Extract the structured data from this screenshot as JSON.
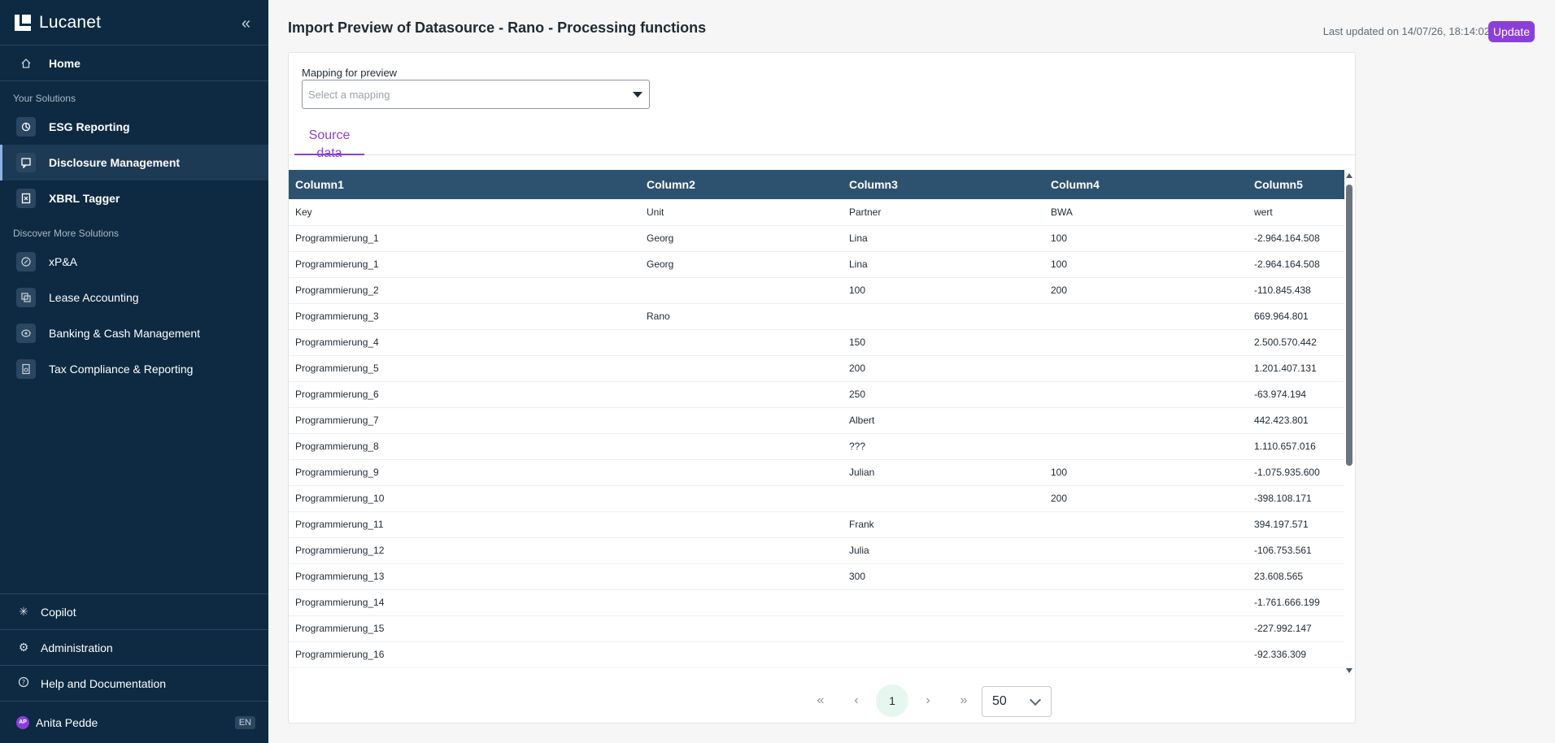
{
  "app": {
    "brand": "Lucanet"
  },
  "sidebar": {
    "home_label": "Home",
    "your_solutions_label": "Your Solutions",
    "your_solutions": [
      {
        "label": "ESG Reporting",
        "icon": "esg-icon"
      },
      {
        "label": "Disclosure Management",
        "icon": "disclosure-icon",
        "active": true
      },
      {
        "label": "XBRL Tagger",
        "icon": "xbrl-icon"
      }
    ],
    "discover_label": "Discover More Solutions",
    "discover": [
      {
        "label": "xP&A",
        "icon": "xpa-icon"
      },
      {
        "label": "Lease Accounting",
        "icon": "lease-icon"
      },
      {
        "label": "Banking & Cash Management",
        "icon": "banking-icon"
      },
      {
        "label": "Tax Compliance & Reporting",
        "icon": "tax-icon"
      }
    ],
    "bottom": {
      "copilot": "Copilot",
      "administration": "Administration",
      "help": "Help and Documentation",
      "user_name": "Anita Pedde",
      "user_initials": "AP",
      "language": "EN"
    }
  },
  "header": {
    "title": "Import Preview of Datasource - Rano - Processing functions",
    "last_updated": "Last updated on 14/07/26, 18:14:02",
    "update_label": "Update"
  },
  "mapping": {
    "label": "Mapping for preview",
    "placeholder": "Select a mapping"
  },
  "tabs": {
    "source_data": "Source data"
  },
  "table": {
    "columns": [
      "Column1",
      "Column2",
      "Column3",
      "Column4",
      "Column5"
    ],
    "rows": [
      [
        "Key",
        "Unit",
        "Partner",
        "BWA",
        "wert"
      ],
      [
        "Programmierung_1",
        "Georg",
        "Lina",
        "100",
        "-2.964.164.508"
      ],
      [
        "Programmierung_1",
        "Georg",
        "Lina",
        "100",
        "-2.964.164.508"
      ],
      [
        "Programmierung_2",
        "",
        "100",
        "200",
        "-110.845.438"
      ],
      [
        "Programmierung_3",
        "Rano",
        "",
        "",
        "669.964.801"
      ],
      [
        "Programmierung_4",
        "",
        "150",
        "",
        "2.500.570.442"
      ],
      [
        "Programmierung_5",
        "",
        "200",
        "",
        "1.201.407.131"
      ],
      [
        "Programmierung_6",
        "",
        "250",
        "",
        "-63.974.194"
      ],
      [
        "Programmierung_7",
        "",
        "Albert",
        "",
        "442.423.801"
      ],
      [
        "Programmierung_8",
        "",
        "???",
        "",
        "1.110.657.016"
      ],
      [
        "Programmierung_9",
        "",
        "Julian",
        "100",
        "-1.075.935.600"
      ],
      [
        "Programmierung_10",
        "",
        "",
        "200",
        "-398.108.171"
      ],
      [
        "Programmierung_11",
        "",
        "Frank",
        "",
        "394.197.571"
      ],
      [
        "Programmierung_12",
        "",
        "Julia",
        "",
        "-106.753.561"
      ],
      [
        "Programmierung_13",
        "",
        "300",
        "",
        "23.608.565"
      ],
      [
        "Programmierung_14",
        "",
        "",
        "",
        "-1.761.666.199"
      ],
      [
        "Programmierung_15",
        "",
        "",
        "",
        "-227.992.147"
      ],
      [
        "Programmierung_16",
        "",
        "",
        "",
        "-92.336.309"
      ]
    ]
  },
  "pagination": {
    "current_page": "1",
    "page_size": "50",
    "first_icon": "«",
    "prev_icon": "‹",
    "next_icon": "›",
    "last_icon": "»"
  },
  "colors": {
    "sidebar_bg": "#0d2a42",
    "accent": "#8b3fd9",
    "table_header": "#2c5270"
  }
}
